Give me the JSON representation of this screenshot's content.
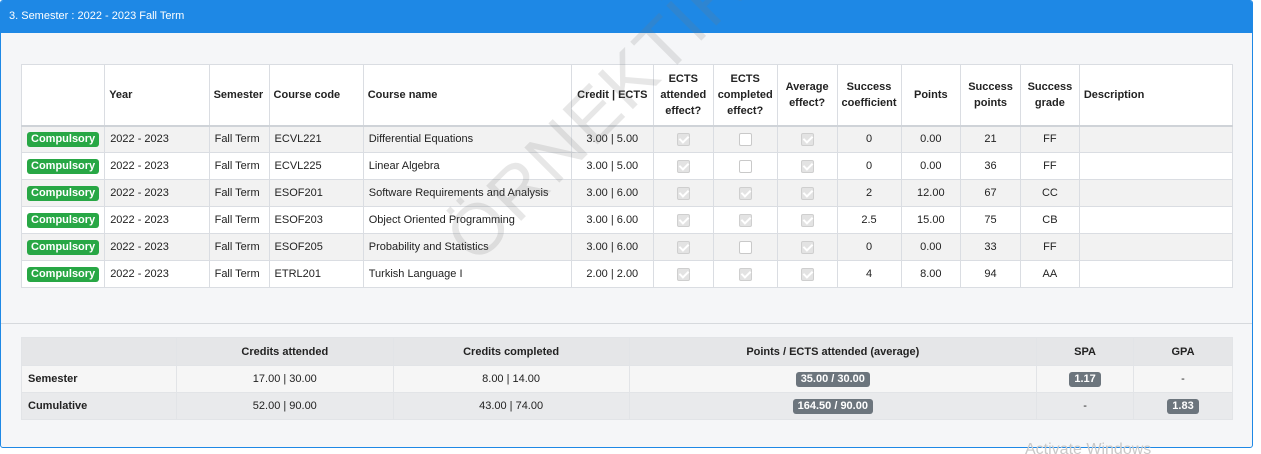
{
  "header": {
    "title": "3. Semester : 2022 - 2023 Fall Term"
  },
  "courses": {
    "columns": [
      "",
      "Year",
      "Semester",
      "Course code",
      "Course name",
      "Credit | ECTS",
      "ECTS attended effect?",
      "ECTS completed effect?",
      "Average effect?",
      "Success coefficient",
      "Points",
      "Success points",
      "Success grade",
      "Description"
    ],
    "rows": [
      {
        "type": "Compulsory",
        "year": "2022 - 2023",
        "semester": "Fall Term",
        "code": "ECVL221",
        "name": "Differential Equations",
        "credit": "3.00 | 5.00",
        "attended": true,
        "completed": false,
        "average": true,
        "coef": "0",
        "points": "0.00",
        "spoints": "21",
        "grade": "FF",
        "desc": ""
      },
      {
        "type": "Compulsory",
        "year": "2022 - 2023",
        "semester": "Fall Term",
        "code": "ECVL225",
        "name": "Linear Algebra",
        "credit": "3.00 | 5.00",
        "attended": true,
        "completed": false,
        "average": true,
        "coef": "0",
        "points": "0.00",
        "spoints": "36",
        "grade": "FF",
        "desc": ""
      },
      {
        "type": "Compulsory",
        "year": "2022 - 2023",
        "semester": "Fall Term",
        "code": "ESOF201",
        "name": "Software Requirements and Analysis",
        "credit": "3.00 | 6.00",
        "attended": true,
        "completed": true,
        "average": true,
        "coef": "2",
        "points": "12.00",
        "spoints": "67",
        "grade": "CC",
        "desc": ""
      },
      {
        "type": "Compulsory",
        "year": "2022 - 2023",
        "semester": "Fall Term",
        "code": "ESOF203",
        "name": "Object Oriented Programming",
        "credit": "3.00 | 6.00",
        "attended": true,
        "completed": true,
        "average": true,
        "coef": "2.5",
        "points": "15.00",
        "spoints": "75",
        "grade": "CB",
        "desc": ""
      },
      {
        "type": "Compulsory",
        "year": "2022 - 2023",
        "semester": "Fall Term",
        "code": "ESOF205",
        "name": "Probability and Statistics",
        "credit": "3.00 | 6.00",
        "attended": true,
        "completed": false,
        "average": true,
        "coef": "0",
        "points": "0.00",
        "spoints": "33",
        "grade": "FF",
        "desc": ""
      },
      {
        "type": "Compulsory",
        "year": "2022 - 2023",
        "semester": "Fall Term",
        "code": "ETRL201",
        "name": "Turkish Language I",
        "credit": "2.00 | 2.00",
        "attended": true,
        "completed": true,
        "average": true,
        "coef": "4",
        "points": "8.00",
        "spoints": "94",
        "grade": "AA",
        "desc": ""
      }
    ]
  },
  "summary": {
    "columns": [
      "",
      "Credits attended",
      "Credits completed",
      "Points / ECTS attended (average)",
      "SPA",
      "GPA"
    ],
    "rows": [
      {
        "label": "Semester",
        "attended": "17.00 | 30.00",
        "completed": "8.00 | 14.00",
        "points": "35.00 / 30.00",
        "spa": "1.17",
        "gpa": "-"
      },
      {
        "label": "Cumulative",
        "attended": "52.00 | 90.00",
        "completed": "43.00 | 74.00",
        "points": "164.50 / 90.00",
        "spa": "-",
        "gpa": "1.83"
      }
    ]
  },
  "watermark": "ÖRNEKTİR",
  "os_overlay": "Activate Windows",
  "colors": {
    "header_blue": "#1e88e5",
    "compulsory_green": "#28a745",
    "badge_gray": "#6c757d"
  }
}
